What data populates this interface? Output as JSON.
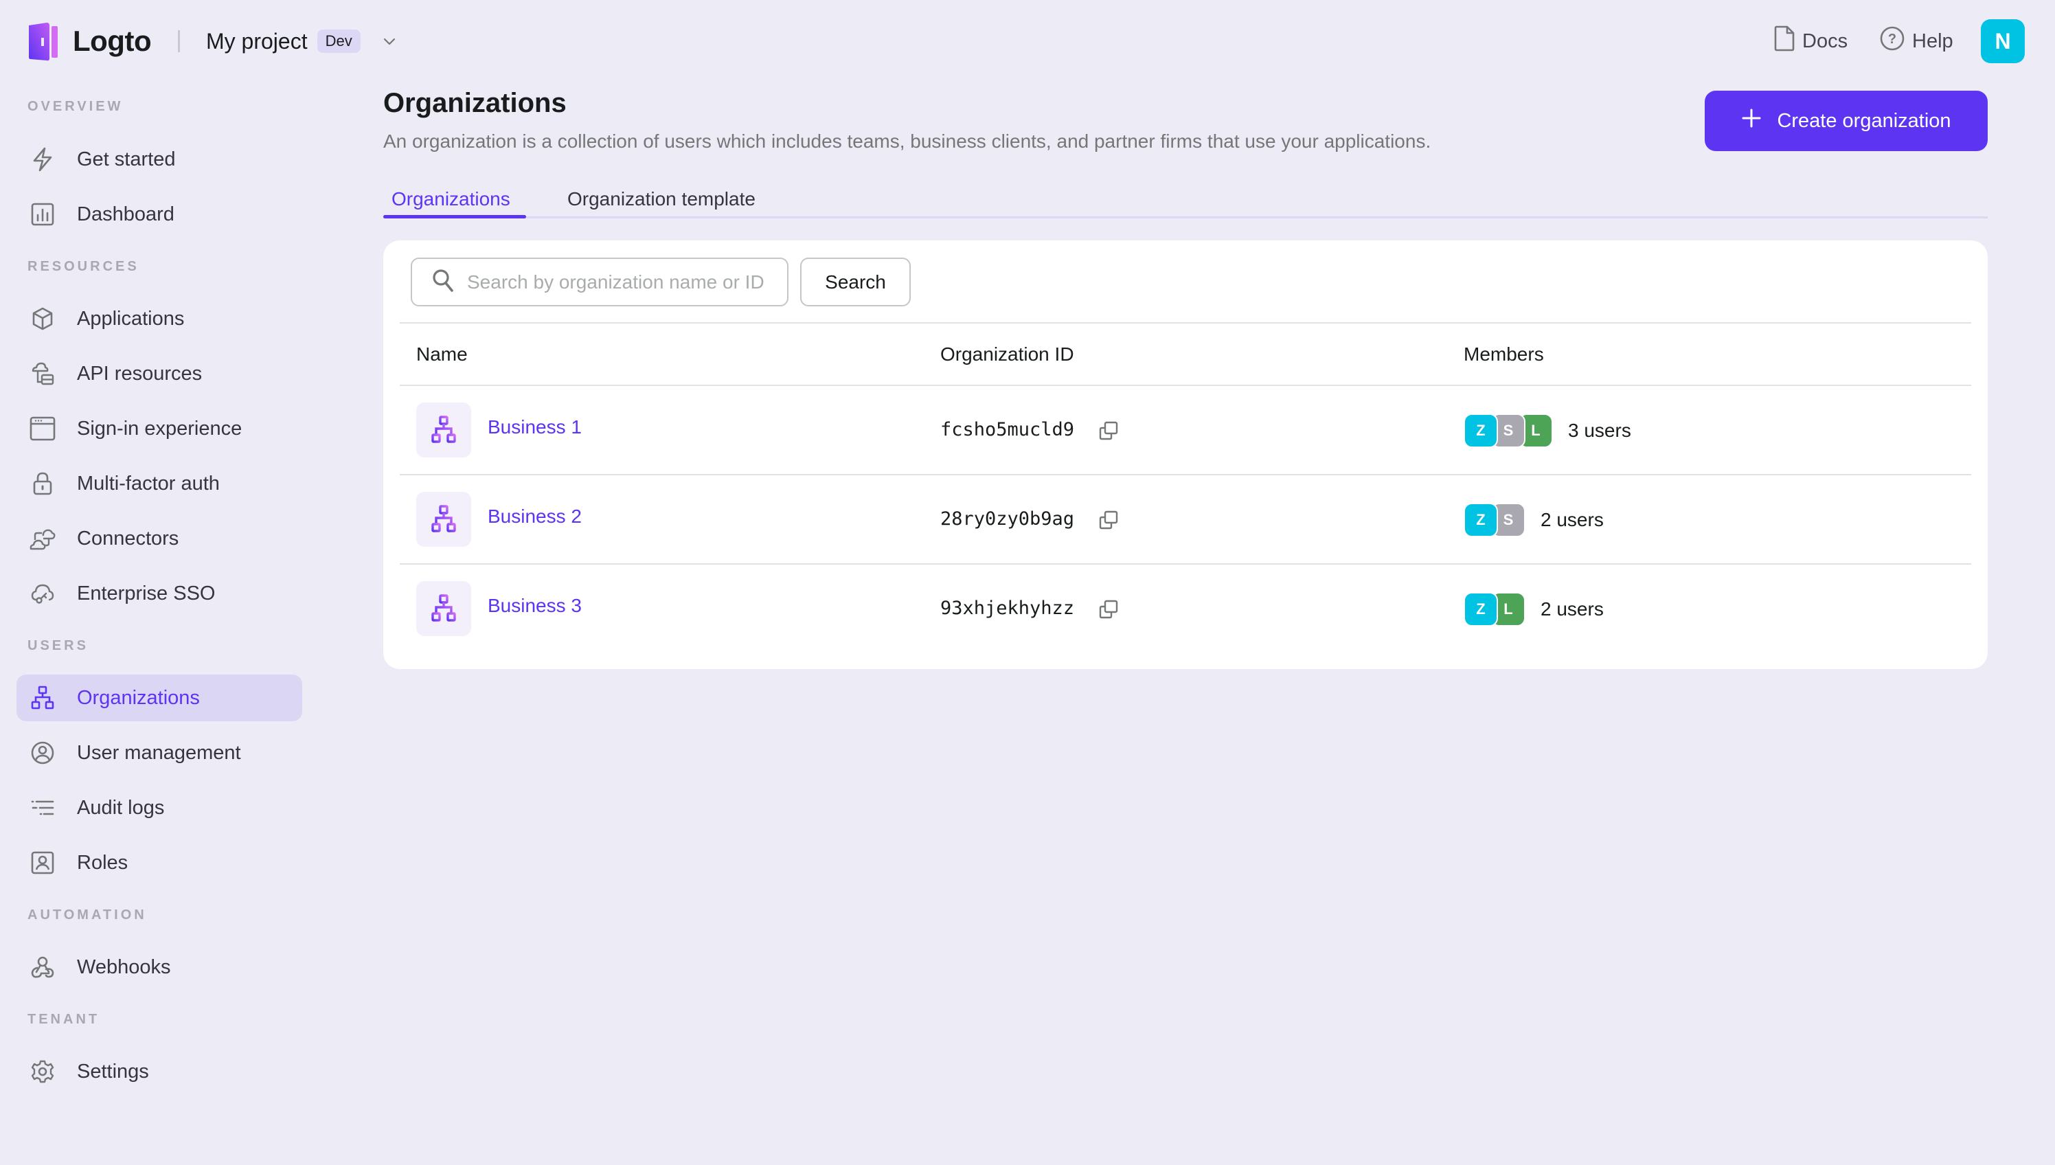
{
  "app": {
    "brand": "Logto",
    "project_name": "My project",
    "environment_tag": "Dev"
  },
  "topbar": {
    "docs_label": "Docs",
    "help_label": "Help",
    "user_avatar_initial": "N",
    "user_avatar_color": "#00C2E2"
  },
  "sidebar": {
    "sections": [
      {
        "label": "OVERVIEW",
        "items": [
          {
            "label": "Get started",
            "icon": "lightning-icon"
          },
          {
            "label": "Dashboard",
            "icon": "bar-chart-icon"
          }
        ]
      },
      {
        "label": "RESOURCES",
        "items": [
          {
            "label": "Applications",
            "icon": "cube-icon"
          },
          {
            "label": "API resources",
            "icon": "cloud-database-icon"
          },
          {
            "label": "Sign-in experience",
            "icon": "browser-window-icon"
          },
          {
            "label": "Multi-factor auth",
            "icon": "lock-icon"
          },
          {
            "label": "Connectors",
            "icon": "cloud-connector-icon"
          },
          {
            "label": "Enterprise SSO",
            "icon": "cloud-key-icon"
          }
        ]
      },
      {
        "label": "USERS",
        "items": [
          {
            "label": "Organizations",
            "icon": "organization-icon",
            "active": true
          },
          {
            "label": "User management",
            "icon": "user-circle-icon"
          },
          {
            "label": "Audit logs",
            "icon": "list-icon"
          },
          {
            "label": "Roles",
            "icon": "user-badge-icon"
          }
        ]
      },
      {
        "label": "AUTOMATION",
        "items": [
          {
            "label": "Webhooks",
            "icon": "webhook-icon"
          }
        ]
      },
      {
        "label": "TENANT",
        "items": [
          {
            "label": "Settings",
            "icon": "gear-icon"
          }
        ]
      }
    ]
  },
  "page": {
    "title": "Organizations",
    "subtitle": "An organization is a collection of users which includes teams, business clients, and partner firms that use your applications.",
    "create_button_label": "Create organization",
    "tabs": [
      {
        "label": "Organizations",
        "active": true
      },
      {
        "label": "Organization template",
        "active": false
      }
    ]
  },
  "search": {
    "placeholder": "Search by organization name or ID",
    "value": "",
    "button_label": "Search"
  },
  "table": {
    "columns": [
      "Name",
      "Organization ID",
      "Members"
    ],
    "rows": [
      {
        "name": "Business 1",
        "id": "fcsho5mucld9",
        "members": [
          {
            "initial": "Z",
            "color": "#00C2E2"
          },
          {
            "initial": "S",
            "color": "#A9A8B0"
          },
          {
            "initial": "L",
            "color": "#4DA356"
          }
        ],
        "member_count_label": "3 users"
      },
      {
        "name": "Business 2",
        "id": "28ry0zy0b9ag",
        "members": [
          {
            "initial": "Z",
            "color": "#00C2E2"
          },
          {
            "initial": "S",
            "color": "#A9A8B0"
          }
        ],
        "member_count_label": "2 users"
      },
      {
        "name": "Business 3",
        "id": "93xhjekhyhzz",
        "members": [
          {
            "initial": "Z",
            "color": "#00C2E2"
          },
          {
            "initial": "L",
            "color": "#4DA356"
          }
        ],
        "member_count_label": "2 users"
      }
    ]
  },
  "colors": {
    "primary": "#5D34F2",
    "background": "#EDEBF5",
    "active_nav_bg": "#DCD6F5"
  }
}
